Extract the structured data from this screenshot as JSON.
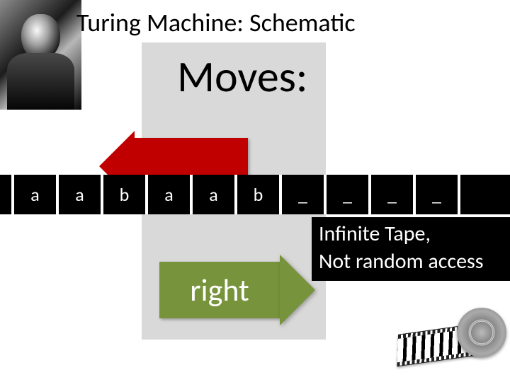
{
  "slide": {
    "title": "Turing Machine: Schematic",
    "moves_label": "Moves:",
    "right_label": "right",
    "info_line1": "Infinite Tape,",
    "info_line2": "Not random access"
  },
  "tape": {
    "cells": [
      "",
      "a",
      "a",
      "b",
      "a",
      "a",
      "b",
      "_",
      "_",
      "_",
      "_"
    ]
  }
}
